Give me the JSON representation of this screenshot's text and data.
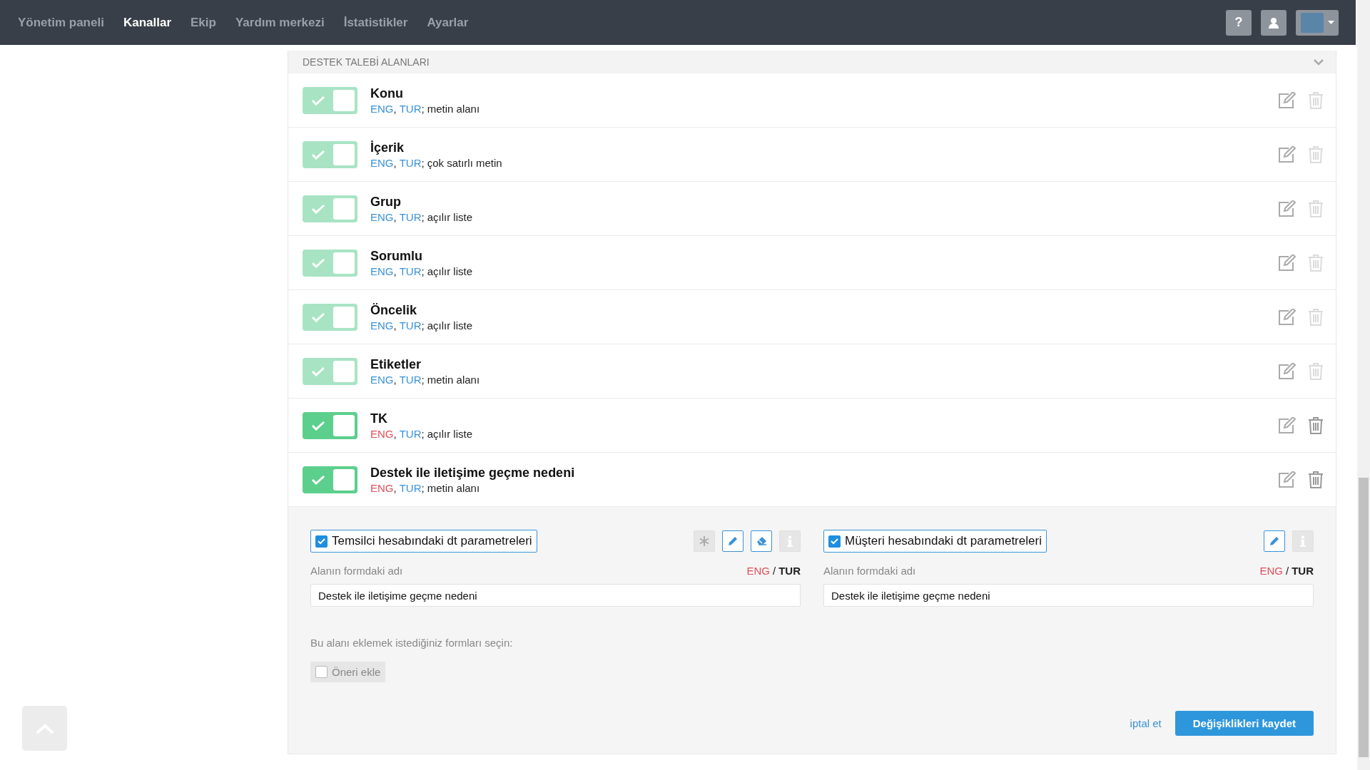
{
  "nav": {
    "items": [
      {
        "label": "Yönetim paneli",
        "selected": false
      },
      {
        "label": "Kanallar",
        "selected": true
      },
      {
        "label": "Ekip",
        "selected": false
      },
      {
        "label": "Yardım merkezi",
        "selected": false
      },
      {
        "label": "İstatistikler",
        "selected": false
      },
      {
        "label": "Ayarlar",
        "selected": false
      }
    ],
    "help": "?"
  },
  "section": {
    "title": "DESTEK TALEBİ ALANLARI",
    "expanded": true
  },
  "fields": [
    {
      "name": "Konu",
      "on": true,
      "locked": true,
      "languages": [
        {
          "code": "ENG",
          "translated": true,
          "separator": ","
        },
        {
          "code": "TUR",
          "translated": true,
          "separator": ";"
        }
      ],
      "type": "metin alanı"
    },
    {
      "name": "İçerik",
      "on": true,
      "locked": true,
      "languages": [
        {
          "code": "ENG",
          "translated": true,
          "separator": ","
        },
        {
          "code": "TUR",
          "translated": true,
          "separator": ";"
        }
      ],
      "type": "çok satırlı metin"
    },
    {
      "name": "Grup",
      "on": true,
      "locked": true,
      "languages": [
        {
          "code": "ENG",
          "translated": true,
          "separator": ","
        },
        {
          "code": "TUR",
          "translated": true,
          "separator": ";"
        }
      ],
      "type": "açılır liste"
    },
    {
      "name": "Sorumlu",
      "on": true,
      "locked": true,
      "languages": [
        {
          "code": "ENG",
          "translated": true,
          "separator": ","
        },
        {
          "code": "TUR",
          "translated": true,
          "separator": ";"
        }
      ],
      "type": "açılır liste"
    },
    {
      "name": "Öncelik",
      "on": true,
      "locked": true,
      "languages": [
        {
          "code": "ENG",
          "translated": true,
          "separator": ","
        },
        {
          "code": "TUR",
          "translated": true,
          "separator": ";"
        }
      ],
      "type": "açılır liste"
    },
    {
      "name": "Etiketler",
      "on": true,
      "locked": true,
      "languages": [
        {
          "code": "ENG",
          "translated": true,
          "separator": ","
        },
        {
          "code": "TUR",
          "translated": true,
          "separator": ";"
        }
      ],
      "type": "metin alanı"
    },
    {
      "name": "TK",
      "on": true,
      "locked": false,
      "languages": [
        {
          "code": "ENG",
          "translated": false,
          "separator": ","
        },
        {
          "code": "TUR",
          "translated": true,
          "separator": ";"
        }
      ],
      "type": "açılır liste"
    },
    {
      "name": "Destek ile iletişime geçme nedeni",
      "on": true,
      "locked": false,
      "languages": [
        {
          "code": "ENG",
          "translated": false,
          "separator": ","
        },
        {
          "code": "TUR",
          "translated": true,
          "separator": ";"
        }
      ],
      "type": "metin alanı"
    }
  ],
  "editor": {
    "columns": [
      {
        "title": "Temsilci hesabındaki dt parametreleri",
        "checked": true,
        "tools": [
          {
            "kind": "required",
            "active": false
          },
          {
            "kind": "edit",
            "active": true
          },
          {
            "kind": "erase",
            "active": true
          },
          {
            "kind": "info",
            "active": false
          }
        ],
        "label": "Alanın formdaki adı",
        "languages": [
          {
            "code": "ENG",
            "translated": false,
            "selected": false,
            "separator": "/"
          },
          {
            "code": "TUR",
            "translated": true,
            "selected": true
          }
        ],
        "value": "Destek ile iletişime geçme nedeni"
      },
      {
        "title": "Müşteri hesabındaki dt parametreleri",
        "checked": true,
        "tools": [
          {
            "kind": "edit",
            "active": true
          },
          {
            "kind": "info",
            "active": false
          }
        ],
        "label": "Alanın formdaki adı",
        "languages": [
          {
            "code": "ENG",
            "translated": false,
            "selected": false,
            "separator": "/"
          },
          {
            "code": "TUR",
            "translated": true,
            "selected": true
          }
        ],
        "value": "Destek ile iletişime geçme nedeni"
      }
    ],
    "forms_prompt": "Bu alanı eklemek istediğiniz formları seçin:",
    "forms": [
      {
        "label": "Öneri ekle",
        "checked": false
      }
    ],
    "cancel": "iptal et",
    "save": "Değişiklikleri kaydet"
  }
}
